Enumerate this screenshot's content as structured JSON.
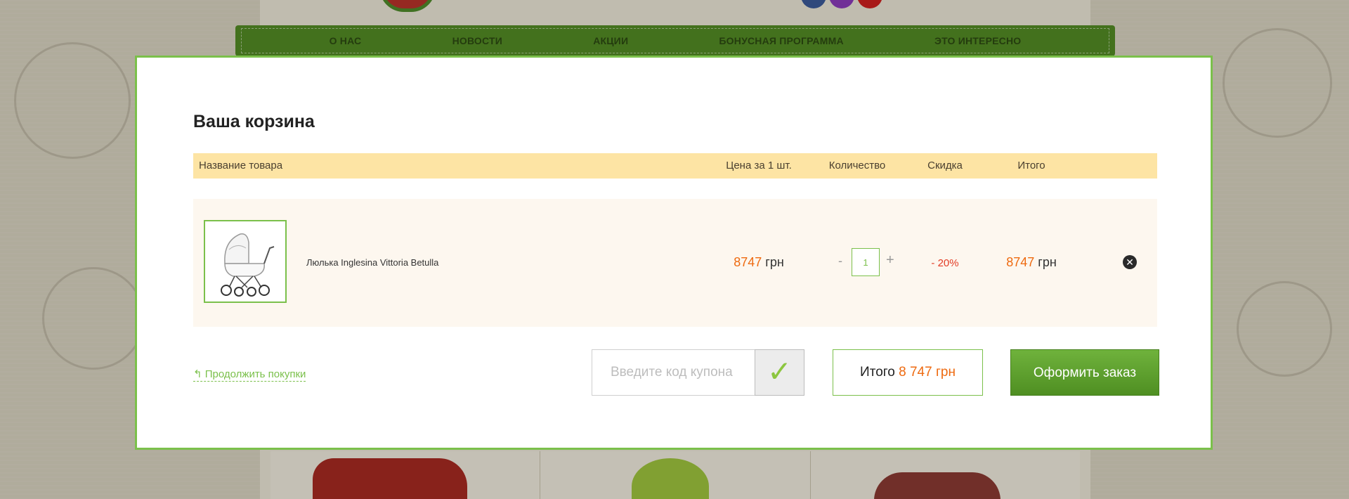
{
  "nav": {
    "items": [
      "О НАС",
      "НОВОСТИ",
      "АКЦИИ",
      "БОНУСНАЯ ПРОГРАММА",
      "ЭТО ИНТЕРЕСНО"
    ]
  },
  "cart": {
    "title": "Ваша корзина",
    "columns": {
      "name": "Название товара",
      "price": "Цена за 1 шт.",
      "quantity": "Количество",
      "discount": "Скидка",
      "total": "Итого"
    },
    "item": {
      "name": "Люлька Inglesina Vittoria Betulla",
      "price_value": "8747",
      "price_currency": "грн",
      "qty_minus": "-",
      "quantity": "1",
      "qty_plus": "+",
      "discount": "- 20%",
      "total_value": "8747",
      "total_currency": "грн",
      "remove_icon": "close-circle-icon"
    },
    "continue_label": "Продолжить покупки",
    "coupon_placeholder": "Введите код купона",
    "coupon_submit_icon": "checkmark-icon",
    "grand_total_label": "Итого",
    "grand_total_value": "8 747 грн",
    "checkout_label": "Оформить заказ"
  },
  "colors": {
    "accent_green": "#7bc04b",
    "price_orange": "#ee6a10",
    "discount_red": "#e23c25",
    "header_yellow": "#fde4a4"
  }
}
